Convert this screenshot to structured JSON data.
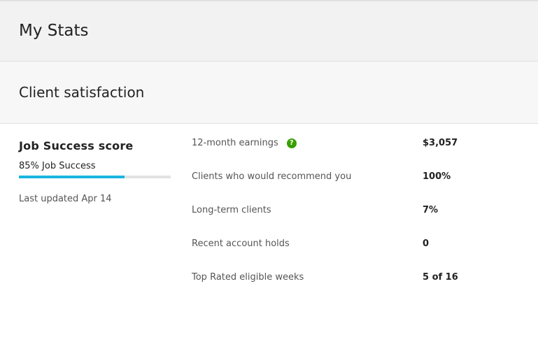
{
  "header": {
    "title": "My Stats"
  },
  "section": {
    "title": "Client satisfaction"
  },
  "score": {
    "title": "Job Success score",
    "label": "85% Job Success",
    "percent": 85,
    "updated": "Last updated Apr 14",
    "bar_color": "#1bb5e0"
  },
  "stats": [
    {
      "label": "12-month earnings",
      "value": "$3,057",
      "help_icon": "question-circle-icon"
    },
    {
      "label": "Clients who would recommend you",
      "value": "100%"
    },
    {
      "label": "Long-term clients",
      "value": "7%"
    },
    {
      "label": "Recent account holds",
      "value": "0"
    },
    {
      "label": "Top Rated eligible weeks",
      "value": "5 of 16"
    }
  ],
  "colors": {
    "help_icon": "#37a000"
  }
}
